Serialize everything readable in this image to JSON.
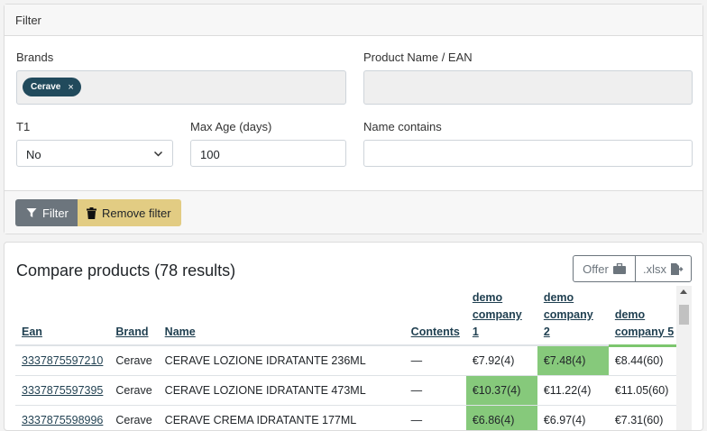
{
  "filter": {
    "header": "Filter",
    "brands_label": "Brands",
    "brand_chip": "Cerave",
    "chip_remove": "×",
    "product_label": "Product Name / EAN",
    "t1_label": "T1",
    "t1_value": "No",
    "max_age_label": "Max Age (days)",
    "max_age_value": "100",
    "name_contains_label": "Name contains",
    "name_contains_value": "",
    "filter_button": "Filter",
    "remove_button": "Remove filter"
  },
  "compare": {
    "title": "Compare products (78 results)",
    "offer_button": "Offer",
    "xlsx_button": ".xlsx",
    "columns": {
      "ean": "Ean",
      "brand": "Brand",
      "name": "Name",
      "contents": "Contents",
      "c1": "demo company 1",
      "c2": "demo company 2",
      "c5": "demo company 5"
    },
    "rows": [
      {
        "ean": "3337875597210",
        "brand": "Cerave",
        "name": "CERAVE LOZIONE IDRATANTE 236ML",
        "contents": "—",
        "c1": "€7.92(4)",
        "c2": "€7.48(4)",
        "c5": "€8.44(60)"
      },
      {
        "ean": "3337875597395",
        "brand": "Cerave",
        "name": "CERAVE LOZIONE IDRATANTE 473ML",
        "contents": "—",
        "c1": "€10.37(4)",
        "c2": "€11.22(4)",
        "c5": "€11.05(60)"
      },
      {
        "ean": "3337875598996",
        "brand": "Cerave",
        "name": "CERAVE CREMA IDRATANTE 177ML",
        "contents": "—",
        "c1": "€6.86(4)",
        "c2": "€6.97(4)",
        "c5": "€7.31(60)"
      }
    ]
  },
  "colors": {
    "accent": "#214a5c",
    "best_price": "#86c97b",
    "remove_button": "#e2cc83",
    "filter_button": "#6c757d"
  }
}
